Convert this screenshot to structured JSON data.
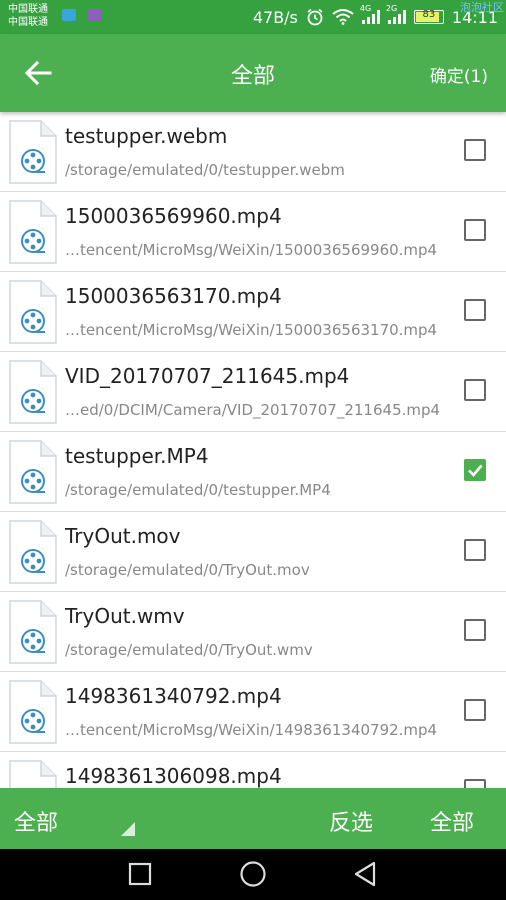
{
  "status_bar": {
    "carrier_1": "中国联通",
    "carrier_2": "中国联通",
    "net_speed": "47B/s",
    "signal_1_tag": "4G",
    "signal_2_tag": "2G",
    "battery": "83",
    "time": "14:11",
    "watermark": "泡泡社区"
  },
  "app_bar": {
    "title": "全部",
    "confirm_label": "确定(1)"
  },
  "files": [
    {
      "name": "testupper.webm",
      "path": "/storage/emulated/0/testupper.webm",
      "checked": false
    },
    {
      "name": "1500036569960.mp4",
      "path": "…tencent/MicroMsg/WeiXin/1500036569960.mp4",
      "checked": false
    },
    {
      "name": "1500036563170.mp4",
      "path": "…tencent/MicroMsg/WeiXin/1500036563170.mp4",
      "checked": false
    },
    {
      "name": "VID_20170707_211645.mp4",
      "path": "…ed/0/DCIM/Camera/VID_20170707_211645.mp4",
      "checked": false
    },
    {
      "name": "testupper.MP4",
      "path": "/storage/emulated/0/testupper.MP4",
      "checked": true
    },
    {
      "name": "TryOut.mov",
      "path": "/storage/emulated/0/TryOut.mov",
      "checked": false
    },
    {
      "name": "TryOut.wmv",
      "path": "/storage/emulated/0/TryOut.wmv",
      "checked": false
    },
    {
      "name": "1498361340792.mp4",
      "path": "…tencent/MicroMsg/WeiXin/1498361340792.mp4",
      "checked": false
    },
    {
      "name": "1498361306098.mp4",
      "path": "",
      "checked": false
    }
  ],
  "bottom_bar": {
    "filter_label": "全部",
    "invert_label": "反选",
    "select_all_label": "全部"
  },
  "colors": {
    "primary": "#4caf50",
    "status_bar": "#36a13f"
  }
}
